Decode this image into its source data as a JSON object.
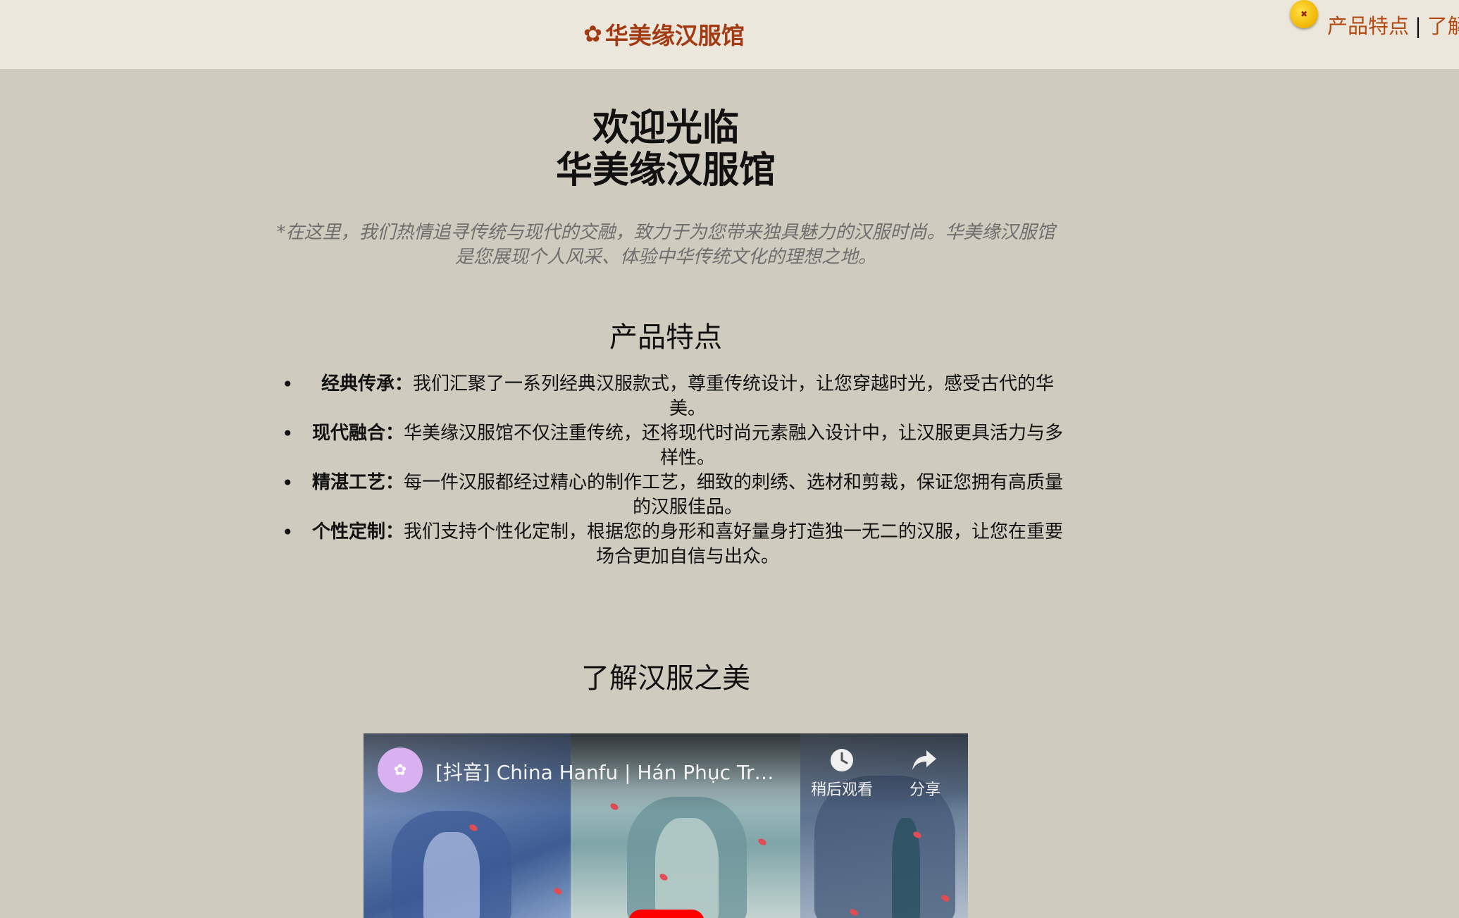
{
  "header": {
    "brand_icon": "flower-icon",
    "brand": "华美缘汉服馆",
    "nav_icon": "coin-icon",
    "nav": [
      "产品特点",
      "了解"
    ],
    "separator": "|"
  },
  "hero": {
    "title_line1": "欢迎光临",
    "title_line2": "华美缘汉服馆",
    "intro": "*在这里，我们热情追寻传统与现代的交融，致力于为您带来独具魅力的汉服时尚。华美缘汉服馆是您展现个人风采、体验中华传统文化的理想之地。"
  },
  "features": {
    "heading": "产品特点",
    "items": [
      {
        "title": "经典传承：",
        "text": "我们汇聚了一系列经典汉服款式，尊重传统设计，让您穿越时光，感受古代的华美。"
      },
      {
        "title": "现代融合：",
        "text": "华美缘汉服馆不仅注重传统，还将现代时尚元素融入设计中，让汉服更具活力与多样性。"
      },
      {
        "title": "精湛工艺：",
        "text": "每一件汉服都经过精心的制作工艺，细致的刺绣、选材和剪裁，保证您拥有高质量的汉服佳品。"
      },
      {
        "title": "个性定制：",
        "text": "我们支持个性化定制，根据您的身形和喜好量身打造独一无二的汉服，让您在重要场合更加自信与出众。"
      }
    ]
  },
  "learn": {
    "heading": "了解汉服之美"
  },
  "video": {
    "title": "[抖音] China Hanfu | Hán Phục Trun...",
    "watch_later": "稍后观看",
    "share": "分享",
    "icons": [
      "clock-icon",
      "share-arrow-icon",
      "play-icon"
    ],
    "accent_color": "#ff0000"
  },
  "colors": {
    "page_bg": "#cfcbbf",
    "header_bg": "#ece7dd",
    "brand": "#a23a12",
    "link": "#b24a12",
    "intro_text": "#6e6e6e"
  }
}
